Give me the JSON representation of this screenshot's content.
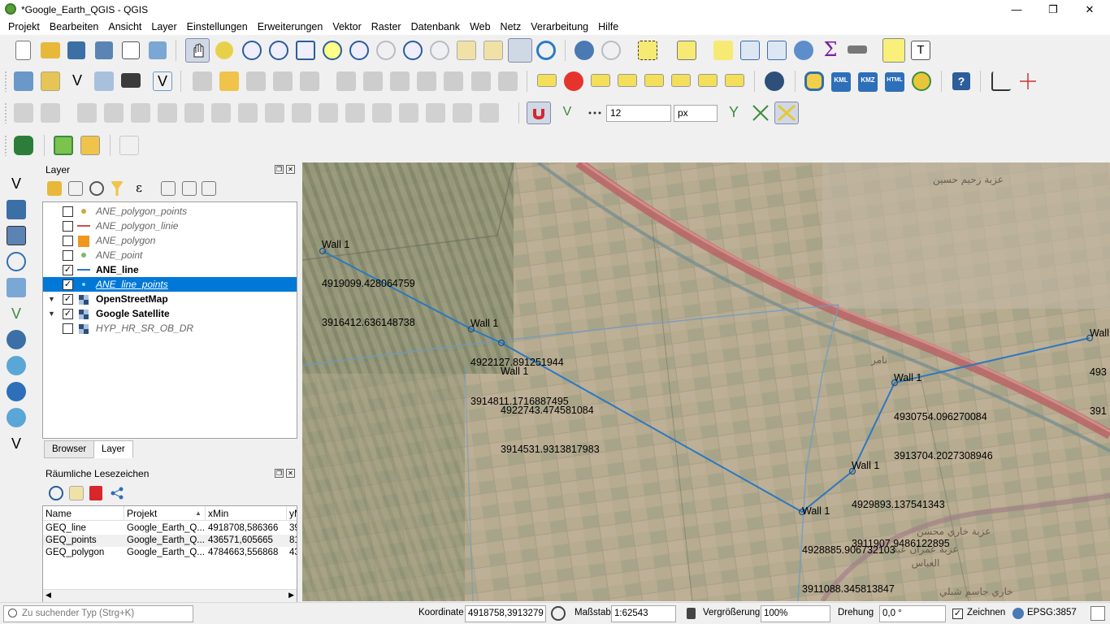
{
  "window": {
    "title": "*Google_Earth_QGIS - QGIS",
    "minimize": "—",
    "maximize": "❐",
    "close": "✕"
  },
  "menu": [
    "Projekt",
    "Bearbeiten",
    "Ansicht",
    "Layer",
    "Einstellungen",
    "Erweiterungen",
    "Vektor",
    "Raster",
    "Datenbank",
    "Web",
    "Netz",
    "Verarbeitung",
    "Hilfe"
  ],
  "snapping": {
    "tolerance": "12",
    "unit": "px"
  },
  "layer_panel": {
    "title": "Layer",
    "layers": [
      {
        "name": "ANE_polygon_points",
        "checked": false,
        "style": "italic",
        "icon": "point-icon"
      },
      {
        "name": "ANE_polygon_linie",
        "checked": false,
        "style": "italic",
        "icon": "line-icon"
      },
      {
        "name": "ANE_polygon",
        "checked": false,
        "style": "italic",
        "icon": "polygon-icon"
      },
      {
        "name": "ANE_point",
        "checked": false,
        "style": "italic",
        "icon": "point-icon"
      },
      {
        "name": "ANE_line",
        "checked": true,
        "style": "bold",
        "icon": "line-icon"
      },
      {
        "name": "ANE_line_points",
        "checked": true,
        "style": "selected",
        "icon": "point-icon"
      },
      {
        "name": "OpenStreetMap",
        "checked": true,
        "style": "bold",
        "icon": "raster-icon",
        "expandable": true
      },
      {
        "name": "Google Satellite",
        "checked": true,
        "style": "bold",
        "icon": "raster-icon",
        "expandable": true
      },
      {
        "name": "HYP_HR_SR_OB_DR",
        "checked": false,
        "style": "italic",
        "icon": "raster-icon"
      }
    ],
    "tabs": [
      "Browser",
      "Layer"
    ]
  },
  "bookmarks_panel": {
    "title": "Räumliche Lesezeichen",
    "columns": [
      "Name",
      "Projekt",
      "xMin",
      "yM"
    ],
    "rows": [
      [
        "GEQ_line",
        "Google_Earth_Q...",
        "4918708,586366",
        "39"
      ],
      [
        "GEQ_points",
        "Google_Earth_Q...",
        "436571,605665",
        "81"
      ],
      [
        "GEQ_polygon",
        "Google_Earth_Q...",
        "4784663,556868",
        "43"
      ]
    ]
  },
  "map": {
    "labels": [
      {
        "name": "Wall 1",
        "x": "4919099.428064759",
        "y": "3916412.636148738"
      },
      {
        "name": "Wall 1",
        "x": "4922127.891251944",
        "y": "3914811.1716887495"
      },
      {
        "name": "Wall 1",
        "x": "4922743.474581084",
        "y": "3914531.9313817983"
      },
      {
        "name": "Wall 1",
        "x": "4930754.096270084",
        "y": "3913704.2027308946"
      },
      {
        "name": "Wall 1",
        "x": "4929893.137541343",
        "y": "3911907.9486122895"
      },
      {
        "name": "Wall 1",
        "x": "4928885.906732103",
        "y": "3911088.345813847"
      },
      {
        "name": "Wall",
        "x": "493",
        "y": "391"
      }
    ],
    "arabic_labels": [
      "عزبة زحيم حسين",
      "نامر",
      "عزبة خاري محسن",
      "عزبة عمران عبد العباس",
      "خاري جاسم شبلي"
    ],
    "line_color": "#2b78c2"
  },
  "status": {
    "search_placeholder": "Zu suchender Typ (Strg+K)",
    "coord_label": "Koordinate",
    "coord_value": "4918758,3913279",
    "scale_label": "Maßstab",
    "scale_value": "1:62543",
    "magnifier_label": "Vergrößerung",
    "magnifier_value": "100%",
    "rotation_label": "Drehung",
    "rotation_value": "0,0 °",
    "render_label": "Zeichnen",
    "crs": "EPSG:3857"
  }
}
